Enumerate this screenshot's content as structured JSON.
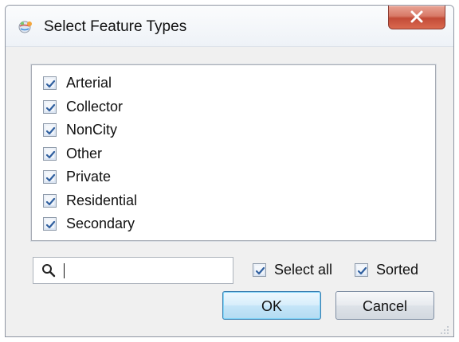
{
  "window": {
    "title": "Select Feature Types",
    "title_icon": "globe-app-icon",
    "close_icon": "close-icon"
  },
  "list": {
    "items": [
      {
        "label": "Arterial",
        "checked": true
      },
      {
        "label": "Collector",
        "checked": true
      },
      {
        "label": "NonCity",
        "checked": true
      },
      {
        "label": "Other",
        "checked": true
      },
      {
        "label": "Private",
        "checked": true
      },
      {
        "label": "Residential",
        "checked": true
      },
      {
        "label": "Secondary",
        "checked": true
      }
    ]
  },
  "search": {
    "value": "",
    "icon": "search-icon"
  },
  "options": {
    "select_all_label": "Select all",
    "select_all_checked": true,
    "sorted_label": "Sorted",
    "sorted_checked": true
  },
  "buttons": {
    "ok_label": "OK",
    "cancel_label": "Cancel"
  },
  "colors": {
    "window_bg": "#f0f0f0",
    "list_bg": "#ffffff",
    "accent": "#3c7fb1",
    "close_button": "#c34b37"
  }
}
